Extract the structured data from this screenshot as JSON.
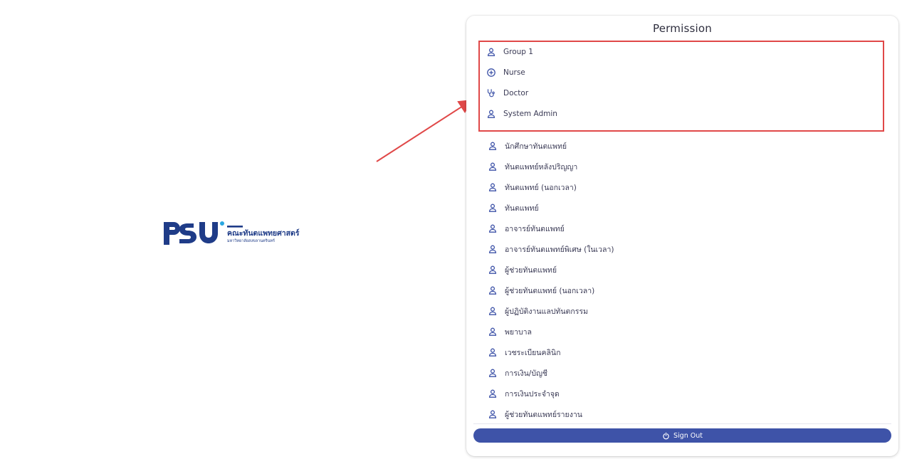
{
  "logo": {
    "mark": "PSU",
    "title": "คณะทันตแพทยศาสตร์",
    "subtitle": "มหาวิทยาลัยสงขลานครินทร์",
    "brand_color": "#1f3c88",
    "accent_color": "#2aa7e0"
  },
  "panel": {
    "title": "Permission",
    "highlighted_items": [
      {
        "label": "Group 1",
        "icon": "person-icon"
      },
      {
        "label": "Nurse",
        "icon": "plus-circle-icon"
      },
      {
        "label": "Doctor",
        "icon": "stethoscope-icon"
      },
      {
        "label": "System Admin",
        "icon": "person-icon"
      }
    ],
    "items": [
      {
        "label": "นักศึกษาทันตแพทย์",
        "icon": "person-icon"
      },
      {
        "label": "ทันตแพทย์หลังปริญญา",
        "icon": "person-icon"
      },
      {
        "label": "ทันตแพทย์ (นอกเวลา)",
        "icon": "person-icon"
      },
      {
        "label": "ทันตแพทย์",
        "icon": "person-icon"
      },
      {
        "label": "อาจารย์ทันตแพทย์",
        "icon": "person-icon"
      },
      {
        "label": "อาจารย์ทันตแพทย์พิเศษ (ในเวลา)",
        "icon": "person-icon"
      },
      {
        "label": "ผู้ช่วยทันตแพทย์",
        "icon": "person-icon"
      },
      {
        "label": "ผู้ช่วยทันตแพทย์ (นอกเวลา)",
        "icon": "person-icon"
      },
      {
        "label": "ผู้ปฏิบัติงานแลปทันตกรรม",
        "icon": "person-icon"
      },
      {
        "label": "พยาบาล",
        "icon": "person-icon"
      },
      {
        "label": "เวชระเบียนคลินิก",
        "icon": "person-icon"
      },
      {
        "label": "การเงิน/บัญชี",
        "icon": "person-icon"
      },
      {
        "label": "การเงินประจำจุด",
        "icon": "person-icon"
      },
      {
        "label": "ผู้ช่วยทันตแพทย์รายงาน",
        "icon": "person-icon"
      }
    ],
    "signout_label": "Sign Out",
    "signout_icon": "power-icon",
    "button_color": "#3e53a8",
    "highlight_color": "#e04848"
  }
}
